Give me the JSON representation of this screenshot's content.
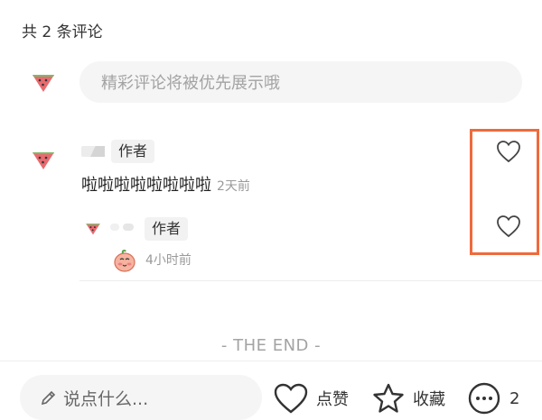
{
  "comments_header": {
    "count_text": "共 2 条评论"
  },
  "comment_input": {
    "placeholder": "精彩评论将被优先展示哦"
  },
  "comments": [
    {
      "author_tag": "作者",
      "text": "啦啦啦啦啦啦啦啦",
      "time": "2天前",
      "replies": [
        {
          "author_tag": "作者",
          "time": "4小时前",
          "content_icon": "peach-emoji-sticker"
        }
      ]
    }
  ],
  "end_marker": "- THE END -",
  "bottom_bar": {
    "input_placeholder": "说点什么...",
    "like_label": "点赞",
    "collect_label": "收藏",
    "comment_count": "2"
  },
  "highlight_color": "#ef6a3c",
  "icons": [
    "watermelon-avatar-icon",
    "heart-icon",
    "pencil-icon",
    "star-icon",
    "comment-bubble-icon",
    "peach-emoji-icon"
  ]
}
